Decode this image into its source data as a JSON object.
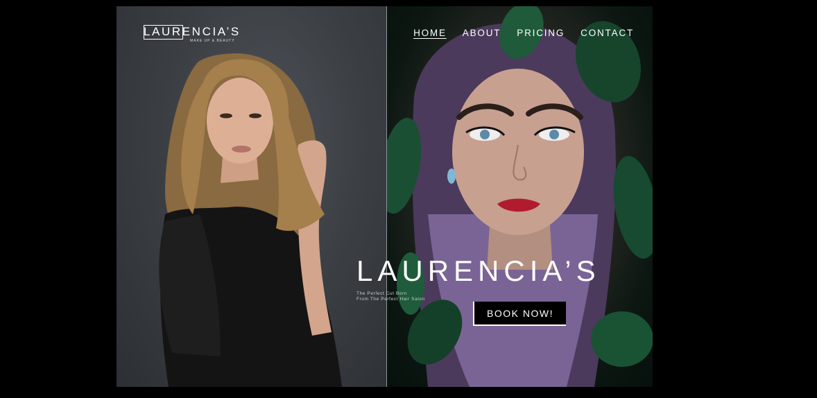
{
  "brand": {
    "logo_text": "LAURENCIA’S",
    "logo_subtitle": "MAKE UP & BEAUTY"
  },
  "nav": {
    "items": [
      {
        "label": "HOME",
        "active": true
      },
      {
        "label": "ABOUT",
        "active": false
      },
      {
        "label": "PRICING",
        "active": false
      },
      {
        "label": "CONTACT",
        "active": false
      }
    ]
  },
  "hero": {
    "title": "LAURENCIA’S",
    "tagline_line1": "The Perfect Cut Born",
    "tagline_line2": "From The Perfect Hair Salon",
    "cta_label": "BOOK NOW!"
  },
  "images": {
    "left": "model-portrait-blonde",
    "right": "model-portrait-purple-hair-leaves"
  },
  "colors": {
    "page_bg": "#000000",
    "left_panel_bg": "#3c4045",
    "right_panel_bg": "#0c1712",
    "button_bg": "#000000",
    "text": "#ffffff",
    "lip_accent": "#b01c2e",
    "leaf_green": "#1f5a3a"
  }
}
